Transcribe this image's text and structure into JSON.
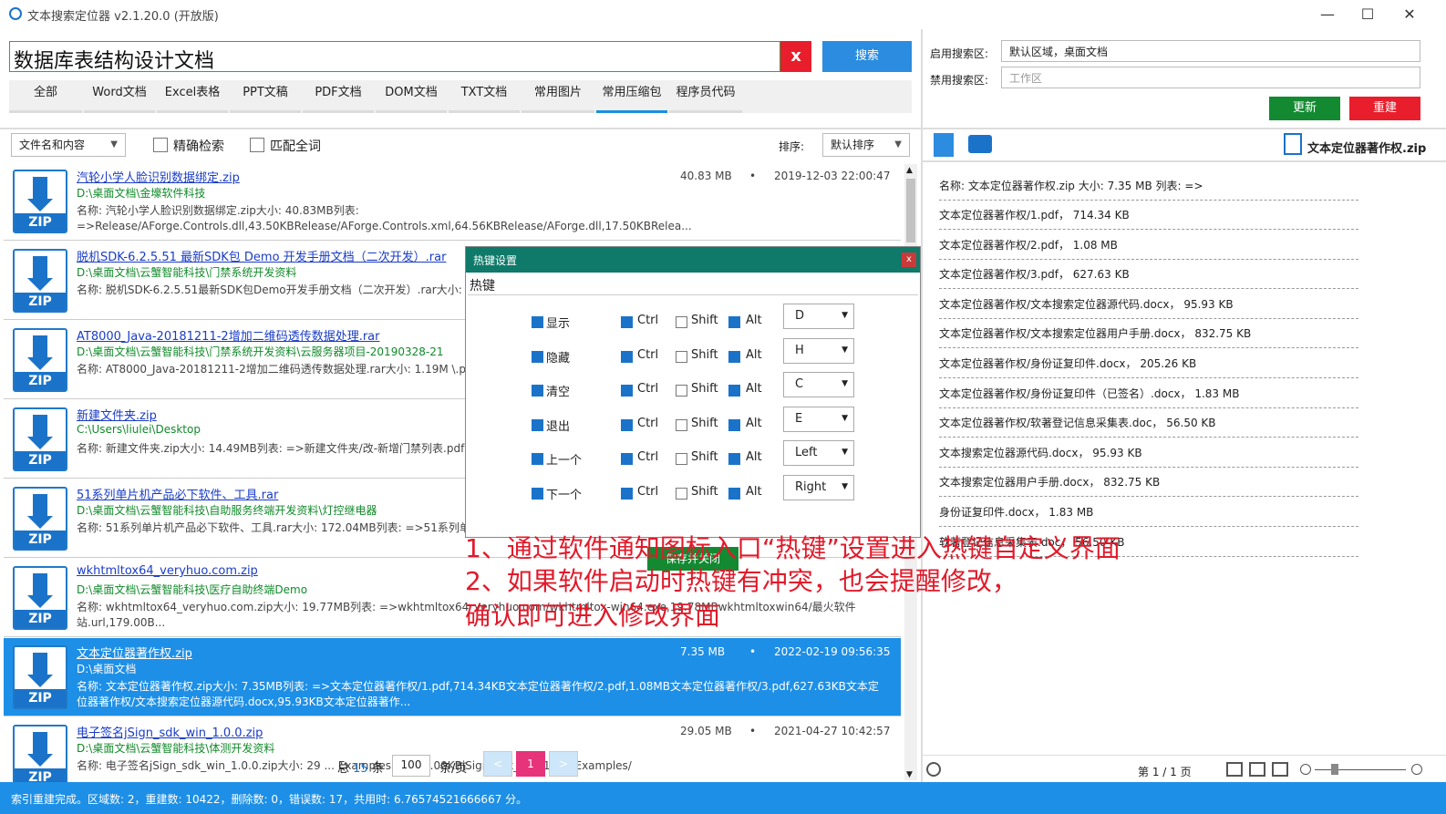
{
  "window": {
    "title": "文本搜索定位器 v2.1.20.0 (开放版)",
    "minimize": "—",
    "maximize": "☐",
    "close": "✕"
  },
  "search": {
    "query": "数据库表结构设计文档",
    "clear_label": "x",
    "search_label": "搜索"
  },
  "tabs": [
    "全部",
    "Word文档",
    "Excel表格",
    "PPT文稿",
    "PDF文档",
    "DOM文档",
    "TXT文档",
    "常用图片",
    "常用压缩包",
    "程序员代码"
  ],
  "active_tab": 8,
  "filter": {
    "mode": "文件名和内容",
    "exact_label": "精确检索",
    "whole_word_label": "匹配全词",
    "sort_label": "排序:",
    "sort_value": "默认排序"
  },
  "results": [
    {
      "name": "汽轮小学人脸识别数据绑定.zip",
      "path": "D:\\桌面文档\\金壕软件科技",
      "desc": "名称: 汽轮小学人脸识别数据绑定.zip大小: 40.83MB列表: =>Release/AForge.Controls.dll,43.50KBRelease/AForge.Controls.xml,64.56KBRelease/AForge.dll,17.50KBRelea...",
      "size": "40.83 MB",
      "date": "2019-12-03 22:00:47"
    },
    {
      "name": "脱机SDK-6.2.5.51 最新SDK包 Demo 开发手册文档（二次开发）.rar",
      "path": "D:\\桌面文档\\云蟹智能科技\\门禁系统开发资料",
      "desc": "名称: 脱机SDK-6.2.5.51最新SDK包Demo开发手册文档（二次开发）.rar大小: (standalone)\\32位Demo\\C#\\Black&White（黑白屏）\\Access...",
      "size": "",
      "date": ""
    },
    {
      "name": "AT8000_Java-20181211-2增加二维码透传数据处理.rar",
      "path": "D:\\桌面文档\\云蟹智能科技\\门禁系统开发资料\\云服务器项目-20190328-21",
      "desc": "名称: AT8000_Java-20181211-2增加二维码透传数据处理.rar大小: 1.19M \\.project,382.00BAT8000_Java\\.settings\\o...",
      "size": "",
      "date": ""
    },
    {
      "name": "新建文件夹.zip",
      "path": "C:\\Users\\liulei\\Desktop",
      "desc": "名称: 新建文件夹.zip大小: 14.49MB列表: =>新建文件夹/改-新增门禁列表.pdf,125.66KB新建文件夹/短报文格式_扩展功能_操作实例_20150506_第",
      "size": "",
      "date": ""
    },
    {
      "name": "51系列单片机产品必下软件、工具.rar",
      "path": "D:\\桌面文档\\云蟹智能科技\\自助服务终端开发资料\\灯控继电器",
      "desc": "名称: 51系列单片机产品必下软件、工具.rar大小: 172.04MB列表: =>51系列单片机产品必下软件、工具\\C语言+Proteus软件仿真参考程序.rar,7.87MB51系",
      "size": "",
      "date": ""
    },
    {
      "name": "wkhtmltox64_veryhuo.com.zip",
      "path": "D:\\桌面文档\\云蟹智能科技\\医疗自助终端Demo",
      "desc": "名称: wkhtmltox64_veryhuo.com.zip大小: 19.77MB列表: =>wkhtmltox64_veryhuo.com/wkhtmltox-win64.exe,19.78MBwkhtmltoxwin64/最火软件站.url,179.00B...",
      "size": "",
      "date": ""
    },
    {
      "name": "文本定位器著作权.zip",
      "path": "D:\\桌面文档",
      "desc": "名称: 文本定位器著作权.zip大小: 7.35MB列表: =>文本定位器著作权/1.pdf,714.34KB文本定位器著作权/2.pdf,1.08MB文本定位器著作权/3.pdf,627.63KB文本定位器著作权/文本搜索定位器源代码.docx,95.93KB文本定位器著作...",
      "size": "7.35 MB",
      "date": "2022-02-19 09:56:35"
    },
    {
      "name": "电子签名jSign_sdk_win_1.0.0.zip",
      "path": "D:\\桌面文档\\云蟹智能科技\\体测开发资料",
      "desc": "名称: 电子签名jSign_sdk_win_1.0.0.zip大小: 29 ... Examples.html,2.00KBjSign_sdk_win_1.0.0/Examples/",
      "size": "29.05 MB",
      "date": "2021-04-27 10:42:57"
    }
  ],
  "selected_result": 6,
  "pager": {
    "total_prefix": "总",
    "total": "15",
    "total_suffix": "条",
    "page_size": "100",
    "per_page": "条/页",
    "prev": "<",
    "current": "1",
    "next": ">"
  },
  "right": {
    "enable_label": "启用搜索区:",
    "enable_value": "默认区域，桌面文档",
    "disable_label": "禁用搜索区:",
    "disable_placeholder": "工作区",
    "update_label": "更新",
    "rebuild_label": "重建",
    "zip_title": "文本定位器著作权.zip",
    "summary": "名称: 文本定位器著作权.zip   大小: 7.35 MB   列表: =>",
    "entries": [
      "文本定位器著作权/1.pdf，  714.34 KB",
      "文本定位器著作权/2.pdf，  1.08 MB",
      "文本定位器著作权/3.pdf，  627.63 KB",
      "文本定位器著作权/文本搜索定位器源代码.docx，  95.93 KB",
      "文本定位器著作权/文本搜索定位器用户手册.docx，  832.75 KB",
      "文本定位器著作权/身份证复印件.docx，  205.26 KB",
      "文本定位器著作权/身份证复印件（已签名）.docx，  1.83 MB",
      "文本定位器著作权/软著登记信息采集表.doc，  56.50 KB",
      "文本搜索定位器源代码.docx，  95.93 KB",
      "文本搜索定位器用户手册.docx，  832.75 KB",
      "身份证复印件.docx，  1.83 MB",
      "软著登记信息采集表.doc，  56.50 KB"
    ],
    "page_info": "第 1 / 1 页"
  },
  "dialog": {
    "title": "热键设置",
    "subtitle": "热键",
    "close": "x",
    "rows": [
      {
        "name": "显示",
        "key": "D"
      },
      {
        "name": "隐藏",
        "key": "H"
      },
      {
        "name": "清空",
        "key": "C"
      },
      {
        "name": "退出",
        "key": "E"
      },
      {
        "name": "上一个",
        "key": "Left"
      },
      {
        "name": "下一个",
        "key": "Right"
      }
    ],
    "ctrl": "Ctrl",
    "shift": "Shift",
    "alt": "Alt",
    "save_label": "保存并关闭"
  },
  "notes": [
    "1、通过软件通知图标入口“热键”设置进入热键自定义界面",
    "2、如果软件启动时热键有冲突，也会提醒修改，",
    "确认即可进入修改界面"
  ],
  "status": "索引重建完成。区域数: 2，重建数: 10422，删除数: 0，错误数: 17，共用时: 6.76574521666667 分。"
}
